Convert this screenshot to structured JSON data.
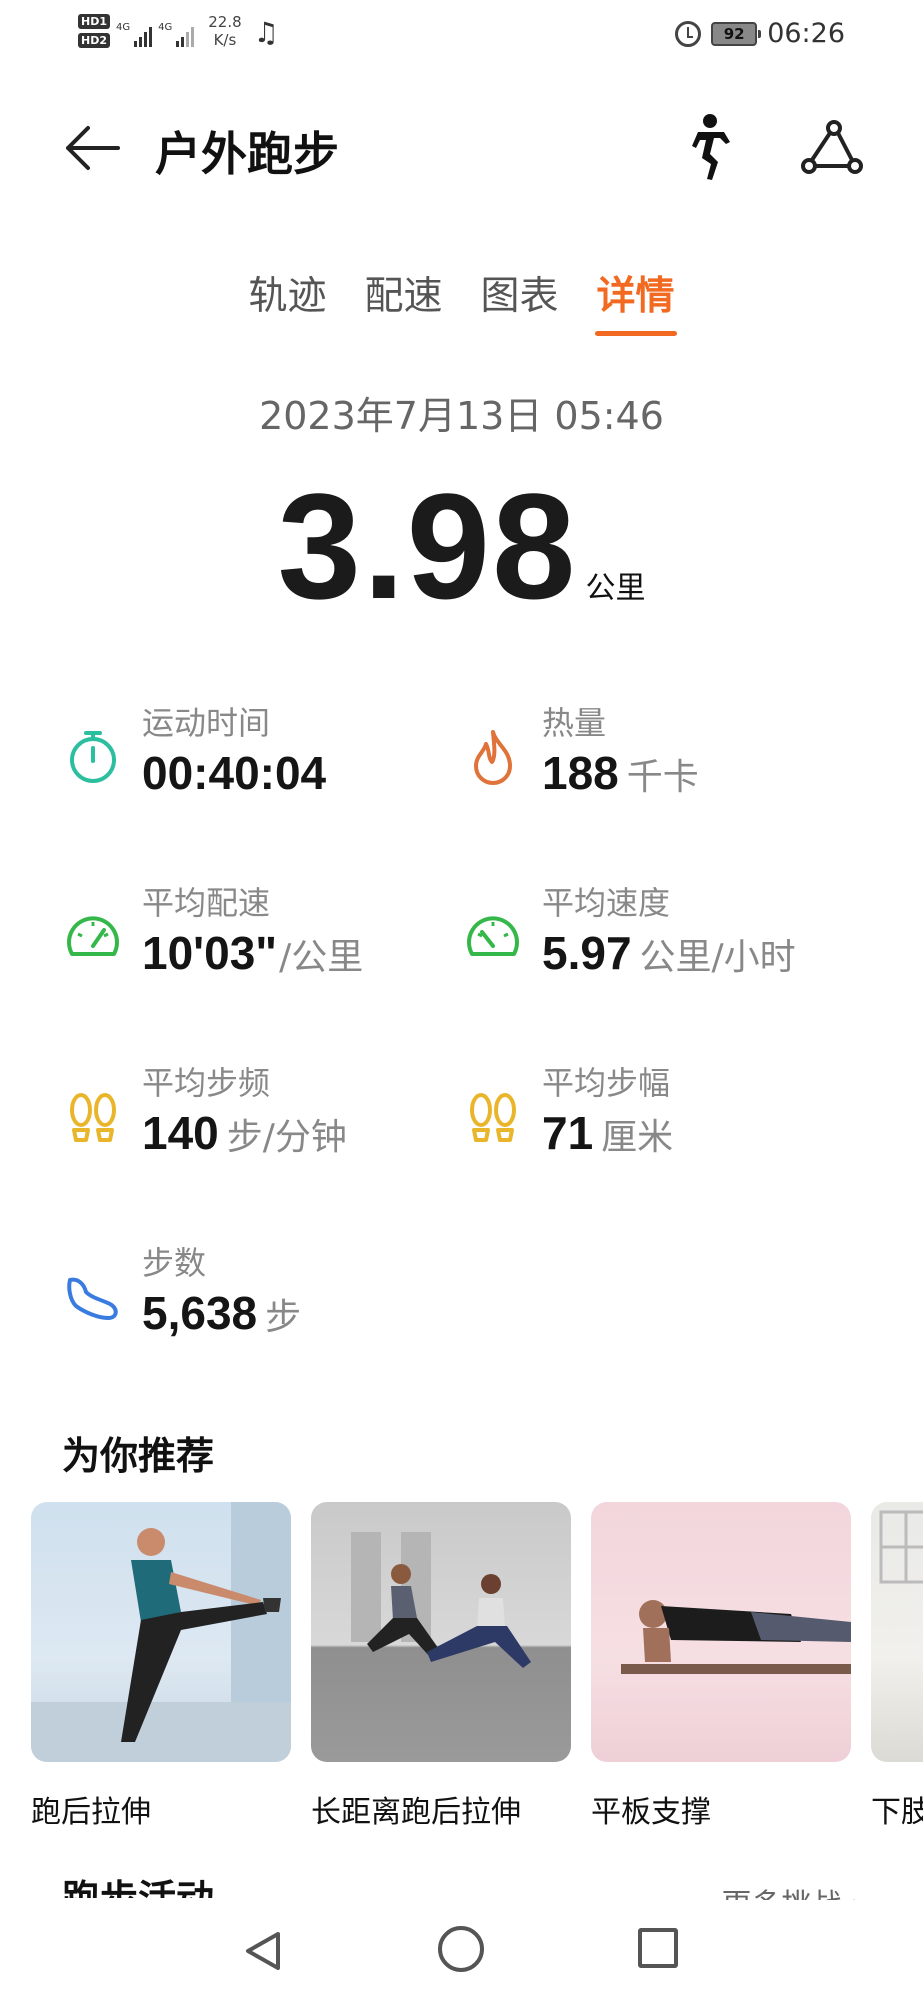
{
  "status_bar": {
    "hd1": "HD1",
    "hd2": "HD2",
    "network1": "4G",
    "network2": "4G",
    "speed_value": "22.8",
    "speed_unit": "K/s",
    "battery": "92",
    "time": "06:26"
  },
  "header": {
    "title": "户外跑步"
  },
  "tabs": [
    {
      "label": "轨迹",
      "active": false
    },
    {
      "label": "配速",
      "active": false
    },
    {
      "label": "图表",
      "active": false
    },
    {
      "label": "详情",
      "active": true
    }
  ],
  "workout": {
    "datetime": "2023年7月13日 05:46",
    "distance": "3.98",
    "distance_unit": "公里"
  },
  "stats": {
    "duration": {
      "label": "运动时间",
      "value": "00:40:04",
      "unit": ""
    },
    "calories": {
      "label": "热量",
      "value": "188",
      "unit": "千卡"
    },
    "avg_pace": {
      "label": "平均配速",
      "value": "10'03\"",
      "unit": "/公里"
    },
    "avg_speed": {
      "label": "平均速度",
      "value": "5.97",
      "unit": "公里/小时"
    },
    "cadence": {
      "label": "平均步频",
      "value": "140",
      "unit": "步/分钟"
    },
    "stride": {
      "label": "平均步幅",
      "value": "71",
      "unit": "厘米"
    },
    "steps": {
      "label": "步数",
      "value": "5,638",
      "unit": "步"
    }
  },
  "recommend": {
    "title": "为你推荐",
    "items": [
      {
        "caption": "跑后拉伸"
      },
      {
        "caption": "长距离跑后拉伸"
      },
      {
        "caption": "平板支撑"
      },
      {
        "caption": "下肢"
      }
    ]
  },
  "activity": {
    "title": "跑步活动",
    "more": "更多挑战"
  },
  "colors": {
    "accent": "#f26a21",
    "teal": "#2bbfa0",
    "green": "#35b84a",
    "yellow": "#e9b62b",
    "orange": "#e0733a",
    "blue": "#3a7be0"
  }
}
